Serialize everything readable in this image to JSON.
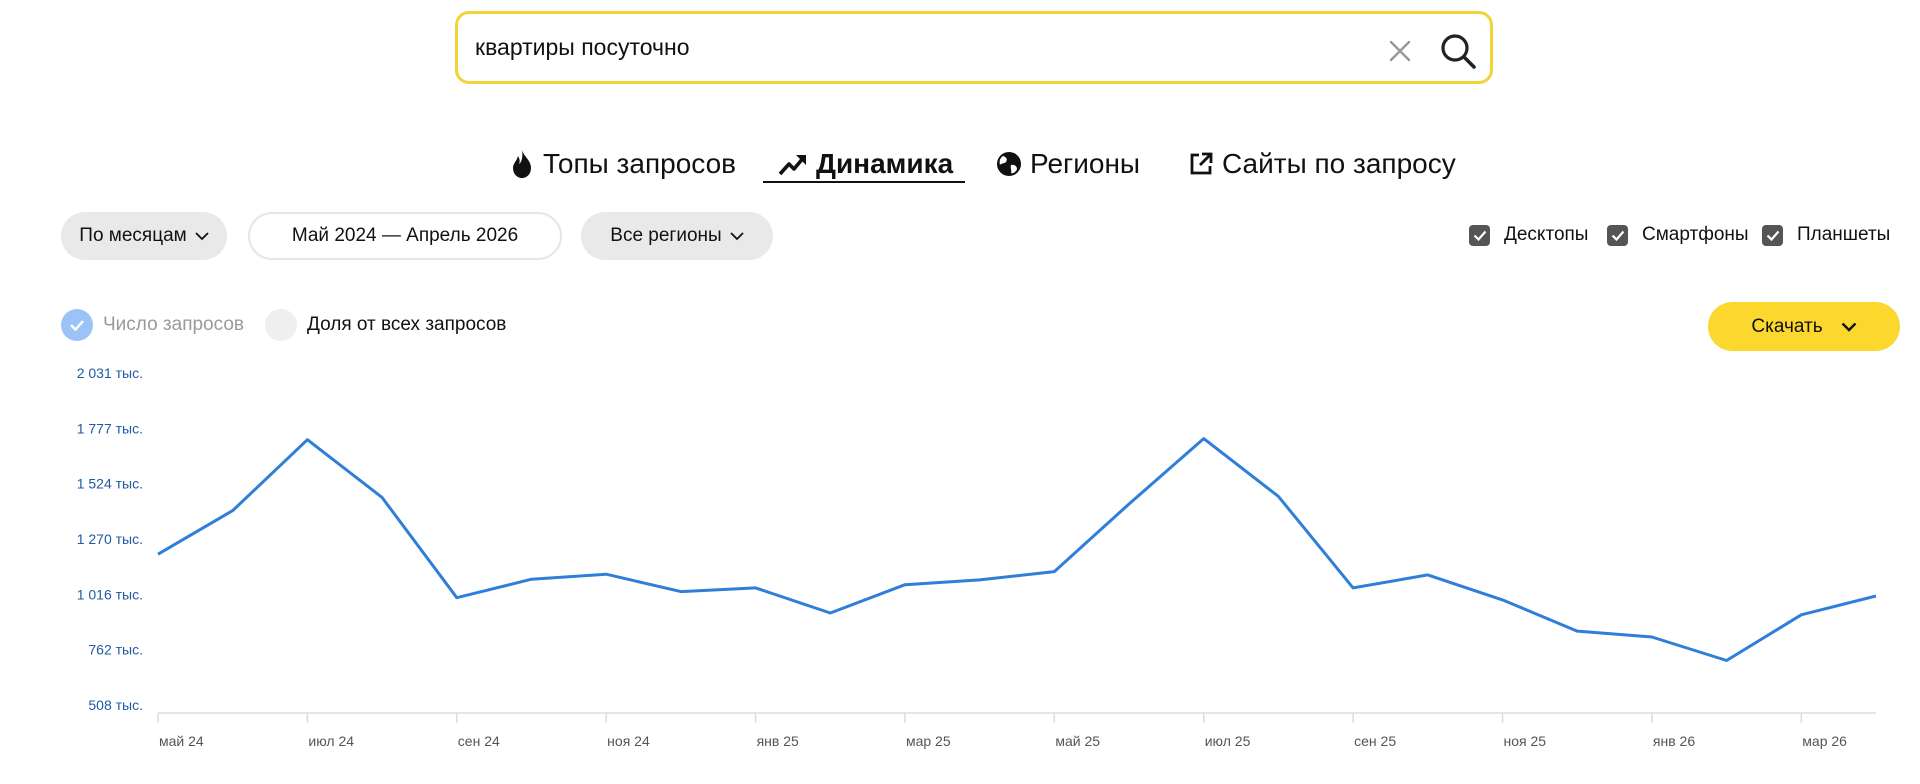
{
  "search": {
    "value": "квартиры посуточно"
  },
  "tabs": [
    {
      "label": "Топы запросов",
      "icon": "flame-icon"
    },
    {
      "label": "Динамика",
      "icon": "trend-up-icon",
      "active": true
    },
    {
      "label": "Регионы",
      "icon": "globe-icon"
    },
    {
      "label": "Сайты по запросу",
      "icon": "external-link-icon"
    }
  ],
  "filters": {
    "period": "По месяцам",
    "date_range": "Май 2024 — Апрель 2026",
    "regions": "Все регионы"
  },
  "devices": [
    {
      "label": "Десктопы",
      "checked": true
    },
    {
      "label": "Смартфоны",
      "checked": true
    },
    {
      "label": "Планшеты",
      "checked": true
    }
  ],
  "metric": {
    "count_label": "Число запросов",
    "share_label": "Доля от всех запросов",
    "selected": "count"
  },
  "download_label": "Скачать",
  "colors": {
    "accent": "#fcd72e",
    "search_border": "#f2d33a",
    "line": "#2f7fd8",
    "axis_label": "#1f5aa6"
  },
  "chart_data": {
    "type": "line",
    "y_ticks": [
      "2 031 тыс.",
      "1 777 тыс.",
      "1 524 тыс.",
      "1 270 тыс.",
      "1 016 тыс.",
      "762 тыс.",
      "508 тыс."
    ],
    "y_tick_values": [
      2031,
      1777,
      1524,
      1270,
      1016,
      762,
      508
    ],
    "ylim": [
      508,
      2031
    ],
    "x_tick_labels": [
      "май 24",
      "июл 24",
      "сен 24",
      "ноя 24",
      "янв 25",
      "мар 25",
      "май 25",
      "июл 25",
      "сен 25",
      "ноя 25",
      "янв 26",
      "мар 26"
    ],
    "x": [
      "май 24",
      "июн 24",
      "июл 24",
      "авг 24",
      "сен 24",
      "окт 24",
      "ноя 24",
      "дек 24",
      "янв 25",
      "фев 25",
      "мар 25",
      "апр 25",
      "май 25",
      "июн 25",
      "июл 25",
      "авг 25",
      "сен 25",
      "окт 25",
      "ноя 25",
      "дек 25",
      "янв 26",
      "фев 26",
      "мар 26",
      "апр 26"
    ],
    "series": [
      {
        "values": [
          1200,
          1400,
          1725,
          1460,
          1000,
          1085,
          1108,
          1028,
          1045,
          930,
          1060,
          1082,
          1120,
          1430,
          1730,
          1465,
          1045,
          1105,
          990,
          847,
          820,
          712,
          922,
          1008
        ]
      }
    ]
  }
}
